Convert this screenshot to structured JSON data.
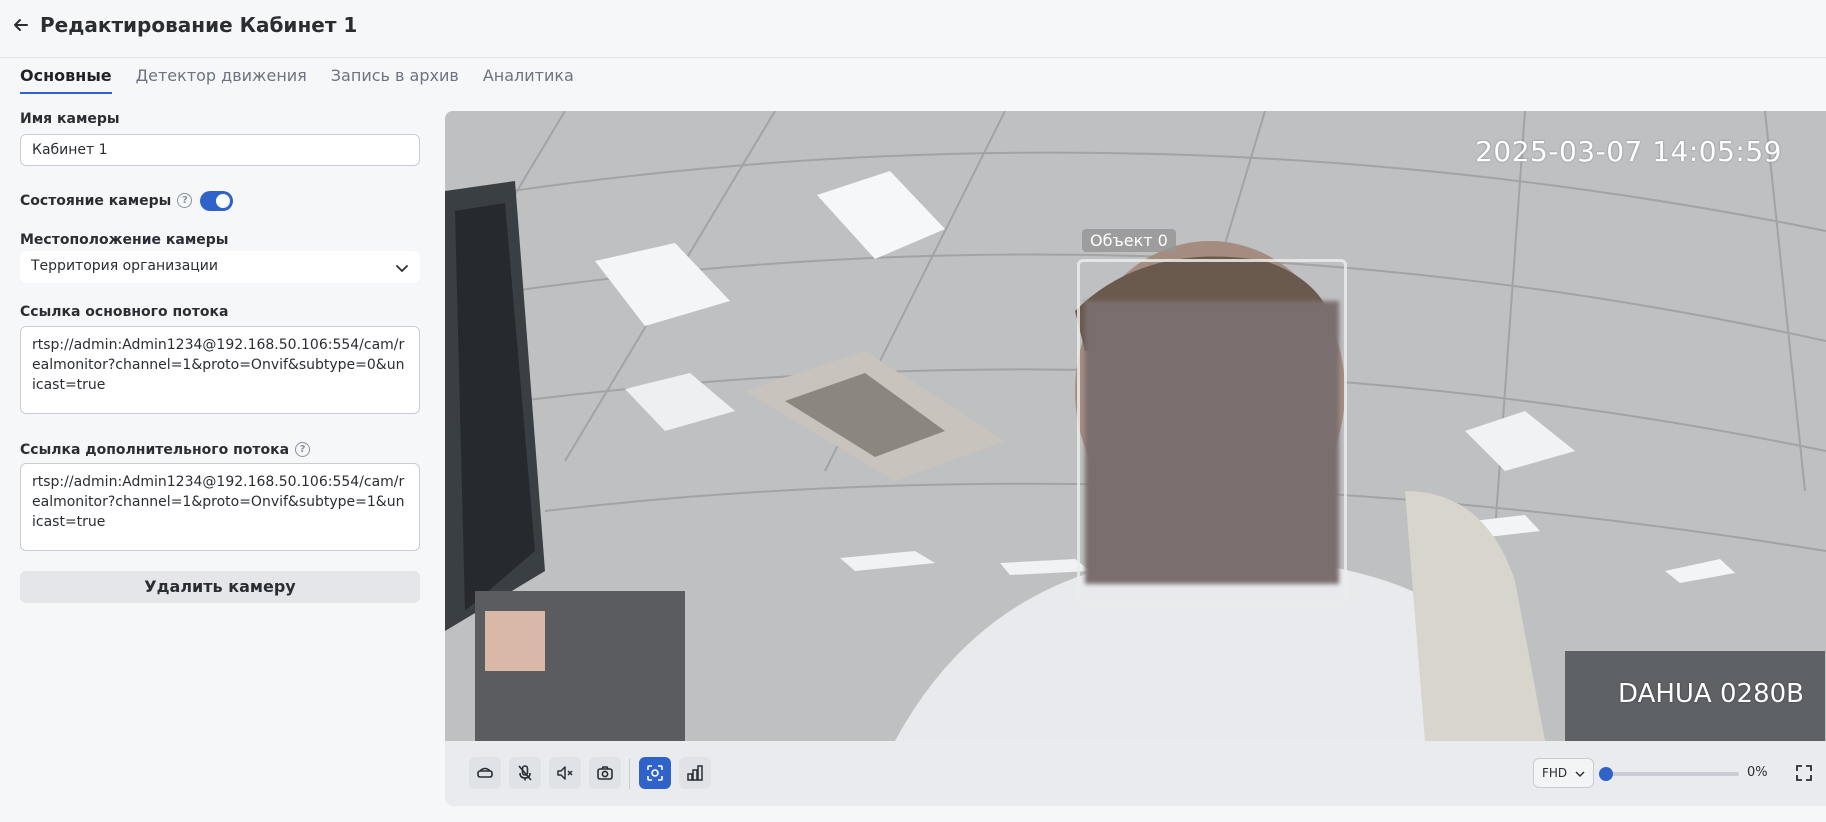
{
  "header": {
    "title": "Редактирование Кабинет 1"
  },
  "tabs": [
    {
      "label": "Основные"
    },
    {
      "label": "Детектор движения"
    },
    {
      "label": "Запись в архив"
    },
    {
      "label": "Аналитика"
    }
  ],
  "form": {
    "camera_name_label": "Имя камеры",
    "camera_name_value": "Кабинет 1",
    "camera_state_label": "Состояние камеры",
    "camera_state_on": true,
    "location_label": "Местоположение камеры",
    "location_value": "Территория организации",
    "main_stream_label": "Ссылка основного потока",
    "main_stream_value": "rtsp://admin:Admin1234@192.168.50.106:554/cam/realmonitor?channel=1&proto=Onvif&subtype=0&unicast=true",
    "extra_stream_label": "Ссылка дополнительного потока",
    "extra_stream_value": "rtsp://admin:Admin1234@192.168.50.106:554/cam/realmonitor?channel=1&proto=Onvif&subtype=1&unicast=true",
    "delete_label": "Удалить камеру"
  },
  "video": {
    "timestamp": "2025-03-07 14:05:59",
    "camera_model": "DAHUA 0280B",
    "object_label": "Объект 0"
  },
  "controls": {
    "quality": "FHD",
    "zoom": "0%",
    "accent": "#2f63c9"
  }
}
